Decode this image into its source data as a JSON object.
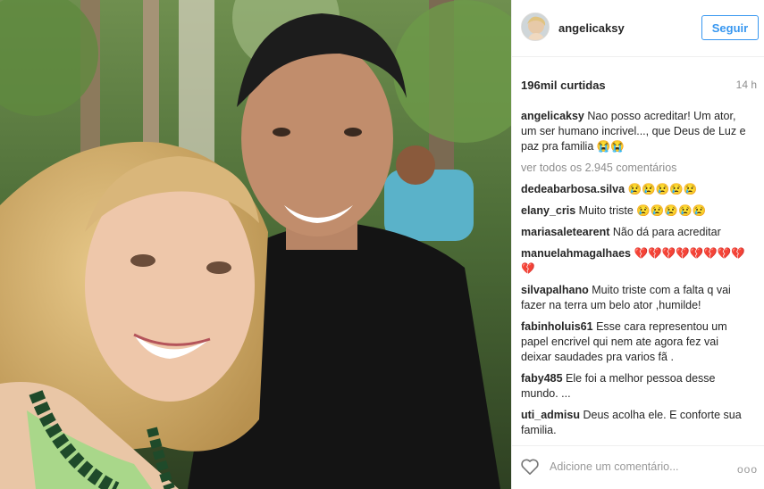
{
  "post": {
    "username": "angelicaksy",
    "follow_label": "Seguir",
    "likes": "196mil curtidas",
    "time": "14 h"
  },
  "caption": {
    "user": "angelicaksy",
    "text": "Nao posso acreditar! Um ator, um ser humano incrivel..., que Deus de Luz e paz pra familia 😭😭"
  },
  "view_all": "ver todos os 2.945 comentários",
  "comments": [
    {
      "user": "dedeabarbosa.silva",
      "text": "😢😢😢😢😢"
    },
    {
      "user": "elany_cris",
      "text": "Muito triste 😢😢😢😢😢"
    },
    {
      "user": "mariasaletearent",
      "text": "Não dá para acreditar"
    },
    {
      "user": "manuelahmagalhaes",
      "text": "💔💔💔💔💔💔💔💔💔"
    },
    {
      "user": "silvapalhano",
      "text": "Muito triste com a falta q vai fazer na terra um belo ator ,humilde!"
    },
    {
      "user": "fabinholuis61",
      "text": "Esse cara representou um papel encrivel qui nem ate agora fez vai deixar saudades pra varios fã ."
    },
    {
      "user": "faby485",
      "text": "Ele foi a melhor pessoa desse mundo. ..."
    },
    {
      "user": "uti_admisu",
      "text": "Deus acolha ele. E conforte sua familia."
    }
  ],
  "footer": {
    "add_comment_placeholder": "Adicione um comentário...",
    "more": "ooo"
  }
}
